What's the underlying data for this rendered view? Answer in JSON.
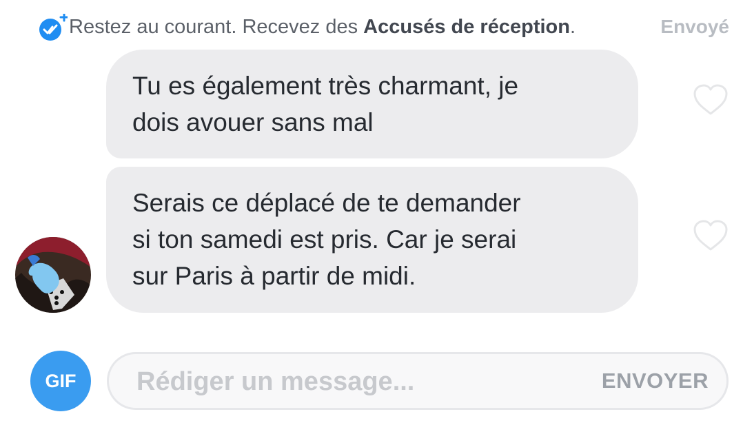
{
  "receipt_banner": {
    "icon": "read-receipt-check-icon",
    "text_before": "Restez au courant. Recevez des ",
    "emphasis": "Accusés de réception",
    "text_after": ".",
    "status": "Envoyé"
  },
  "messages": [
    {
      "text_line_1": "Tu es également très charmant, je",
      "text_line_2": "dois avouer sans mal",
      "like_icon": "heart-outline-icon"
    },
    {
      "text_line_1": "Serais ce déplacé de te demander",
      "text_line_2": "si ton samedi est pris. Car je serai",
      "text_line_3": "sur Paris à partir de midi.",
      "like_icon": "heart-outline-icon"
    }
  ],
  "composer": {
    "gif_label": "GIF",
    "placeholder": "Rédiger un message...",
    "value": "",
    "send_label": "ENVOYER"
  },
  "colors": {
    "accent_blue": "#3a9cf0",
    "bubble_background": "#ececee",
    "muted_text": "#b8bcc2"
  }
}
